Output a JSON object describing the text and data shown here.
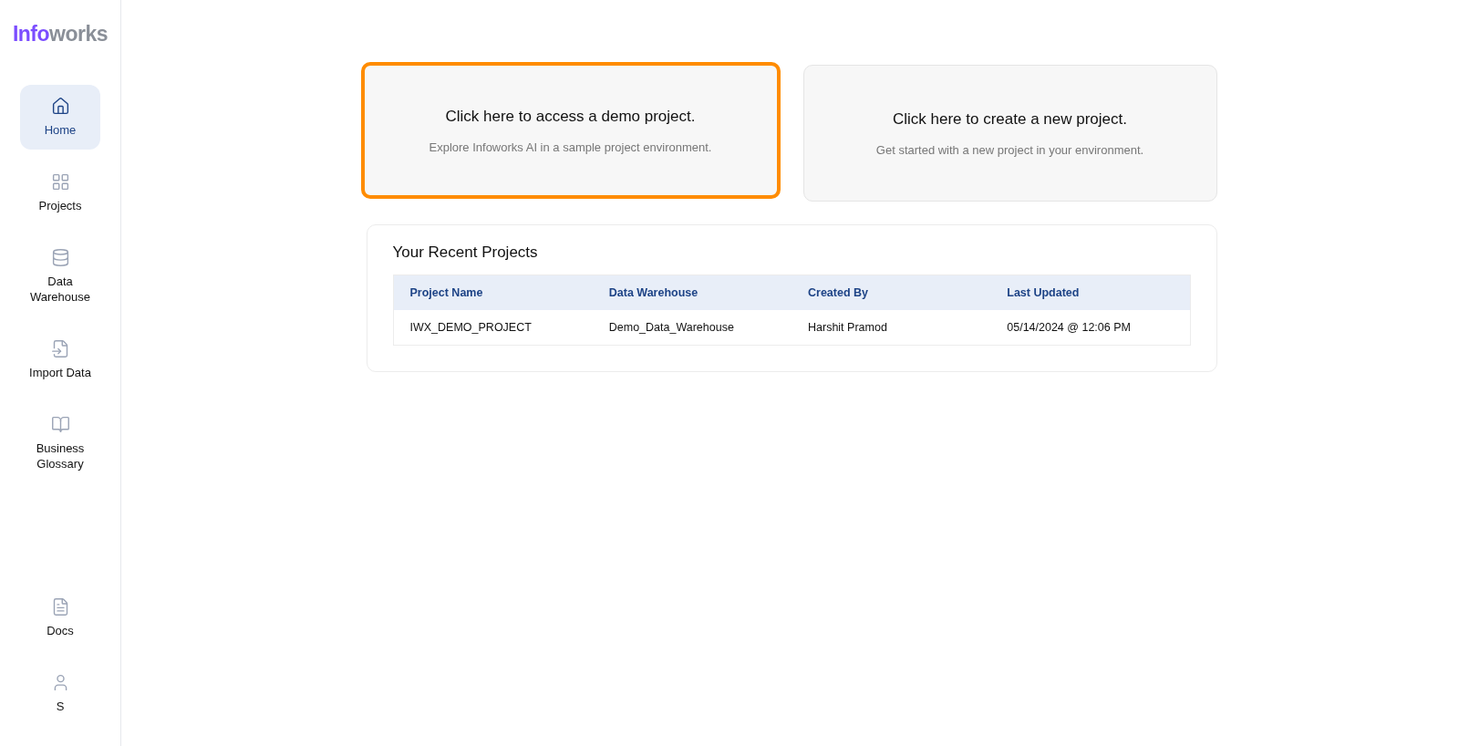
{
  "logo": {
    "accent": "Info",
    "rest": "works"
  },
  "sidebar": {
    "items": [
      {
        "label": "Home",
        "kind": "home",
        "selected": true
      },
      {
        "label": "Projects",
        "kind": "grid",
        "selected": false
      },
      {
        "label": "Data\nWarehouse",
        "kind": "database",
        "selected": false
      },
      {
        "label": "Import Data",
        "kind": "import",
        "selected": false
      },
      {
        "label": "Business\nGlossary",
        "kind": "book",
        "selected": false
      }
    ],
    "bottom_items": [
      {
        "label": "Docs",
        "kind": "doc",
        "selected": false
      },
      {
        "label": "S",
        "kind": "user",
        "selected": false
      }
    ]
  },
  "cards": [
    {
      "title": "Click here to access a demo project.",
      "subtitle": "Explore Infoworks AI in a sample project environment.",
      "highlighted": true
    },
    {
      "title": "Click here to create a new project.",
      "subtitle": "Get started with a new project in your environment.",
      "highlighted": false
    }
  ],
  "recent_projects": {
    "title": "Your Recent Projects",
    "columns": [
      "Project Name",
      "Data Warehouse",
      "Created By",
      "Last Updated"
    ],
    "rows": [
      [
        "IWX_DEMO_PROJECT",
        "Demo_Data_Warehouse",
        "Harshit Pramod",
        "05/14/2024 @ 12:06 PM"
      ]
    ]
  }
}
